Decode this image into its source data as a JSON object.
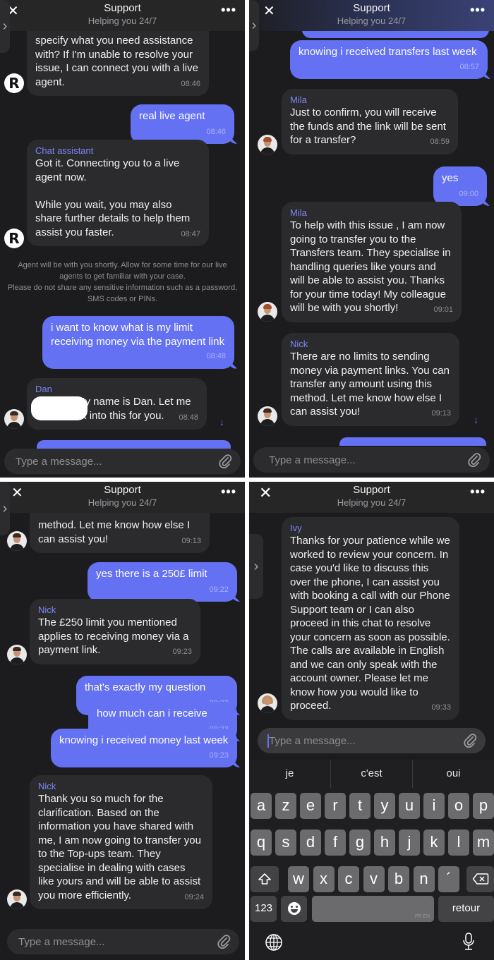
{
  "header": {
    "title": "Support",
    "subtitle": "Helping you 24/7"
  },
  "composer": {
    "placeholder": "Type a message..."
  },
  "colors": {
    "accent": "#6471f3",
    "sender_name": "#7b86f5",
    "background": "#1c1c1e",
    "agent_bubble": "#2b2b2e"
  },
  "panel1": {
    "messages": [
      {
        "sender": "",
        "text": "specify what you need assistance with? If I'm unable to resolve your issue, I can connect you with a live agent.",
        "time": "08:46"
      },
      {
        "text": "real live agent",
        "time": "08:46"
      },
      {
        "sender": "Chat assistant",
        "text": "Got it. Connecting you to a live agent now.\n\nWhile you wait, you may also share further details to help them assist you faster.",
        "time": "08:47"
      },
      {
        "text": "i want to know what is my limit receiving money via the payment link",
        "time": "08:48"
      },
      {
        "sender": "Dan",
        "text": "My name is Dan. Let me take a look into this for you.",
        "time": "08:48"
      }
    ],
    "notice": "Agent will be with you shortly. Allow for some time for our live agents to get familiar with your case.\nPlease do not share any sensitive information such as a password, SMS codes or PINs."
  },
  "panel2": {
    "messages": [
      {
        "text": "knowing i received transfers last week",
        "time": "08:57"
      },
      {
        "sender": "Mila",
        "text": "Just to confirm, you will receive the funds and the link will be sent for a transfer?",
        "time": "08:59"
      },
      {
        "text": "yes",
        "time": "09:00"
      },
      {
        "sender": "Mila",
        "text": "To help with this issue , I am now going to transfer you to the Transfers team. They specialise in handling queries like yours and will be able to assist you. Thanks for your time today! My colleague will be with you shortly!",
        "time": "09:01"
      },
      {
        "sender": "Nick",
        "text": "There are no limits to sending money via payment links. You can transfer any amount using this method. Let me know how else I can assist you!",
        "time": "09:13"
      }
    ]
  },
  "panel3": {
    "messages": [
      {
        "text": "method. Let me know how else I can assist you!",
        "time": "09:13"
      },
      {
        "text": "yes there is a 250£ limit",
        "time": "09:22"
      },
      {
        "sender": "Nick",
        "text": "The £250 limit you mentioned applies to receiving money via a payment link.",
        "time": "09:23"
      },
      {
        "text": "that's exactly my question",
        "time": "09:23"
      },
      {
        "text": "how much can i receive",
        "time": "09:23"
      },
      {
        "text": "knowing i received money last week",
        "time": "09:23"
      },
      {
        "sender": "Nick",
        "text": "Thank you so much for the clarification. Based on the information you have shared with me, I am now going to transfer you to the Top-ups team. They specialise in dealing with cases like yours and will be able to assist you more efficiently.",
        "time": "09:24"
      }
    ]
  },
  "panel4": {
    "messages": [
      {
        "sender": "Ivy",
        "text": "Thanks for your patience while we worked to review your concern. In case you'd like to discuss this over the phone, I can assist you with booking a call with our Phone Support team or I can also proceed in this chat to resolve your concern as soon as possible. The calls are available in English and we can only speak with the account owner. Please let me know how you would like to proceed.",
        "time": "09:33"
      }
    ]
  },
  "keyboard": {
    "suggestions": [
      "je",
      "c'est",
      "oui"
    ],
    "row1": [
      "a",
      "z",
      "e",
      "r",
      "t",
      "y",
      "u",
      "i",
      "o",
      "p"
    ],
    "row2": [
      "q",
      "s",
      "d",
      "f",
      "g",
      "h",
      "j",
      "k",
      "l",
      "m"
    ],
    "row3": [
      "w",
      "x",
      "c",
      "v",
      "b",
      "n",
      "´"
    ],
    "numbers_label": "123",
    "space_tag": "FR EN",
    "return_label": "retour"
  }
}
